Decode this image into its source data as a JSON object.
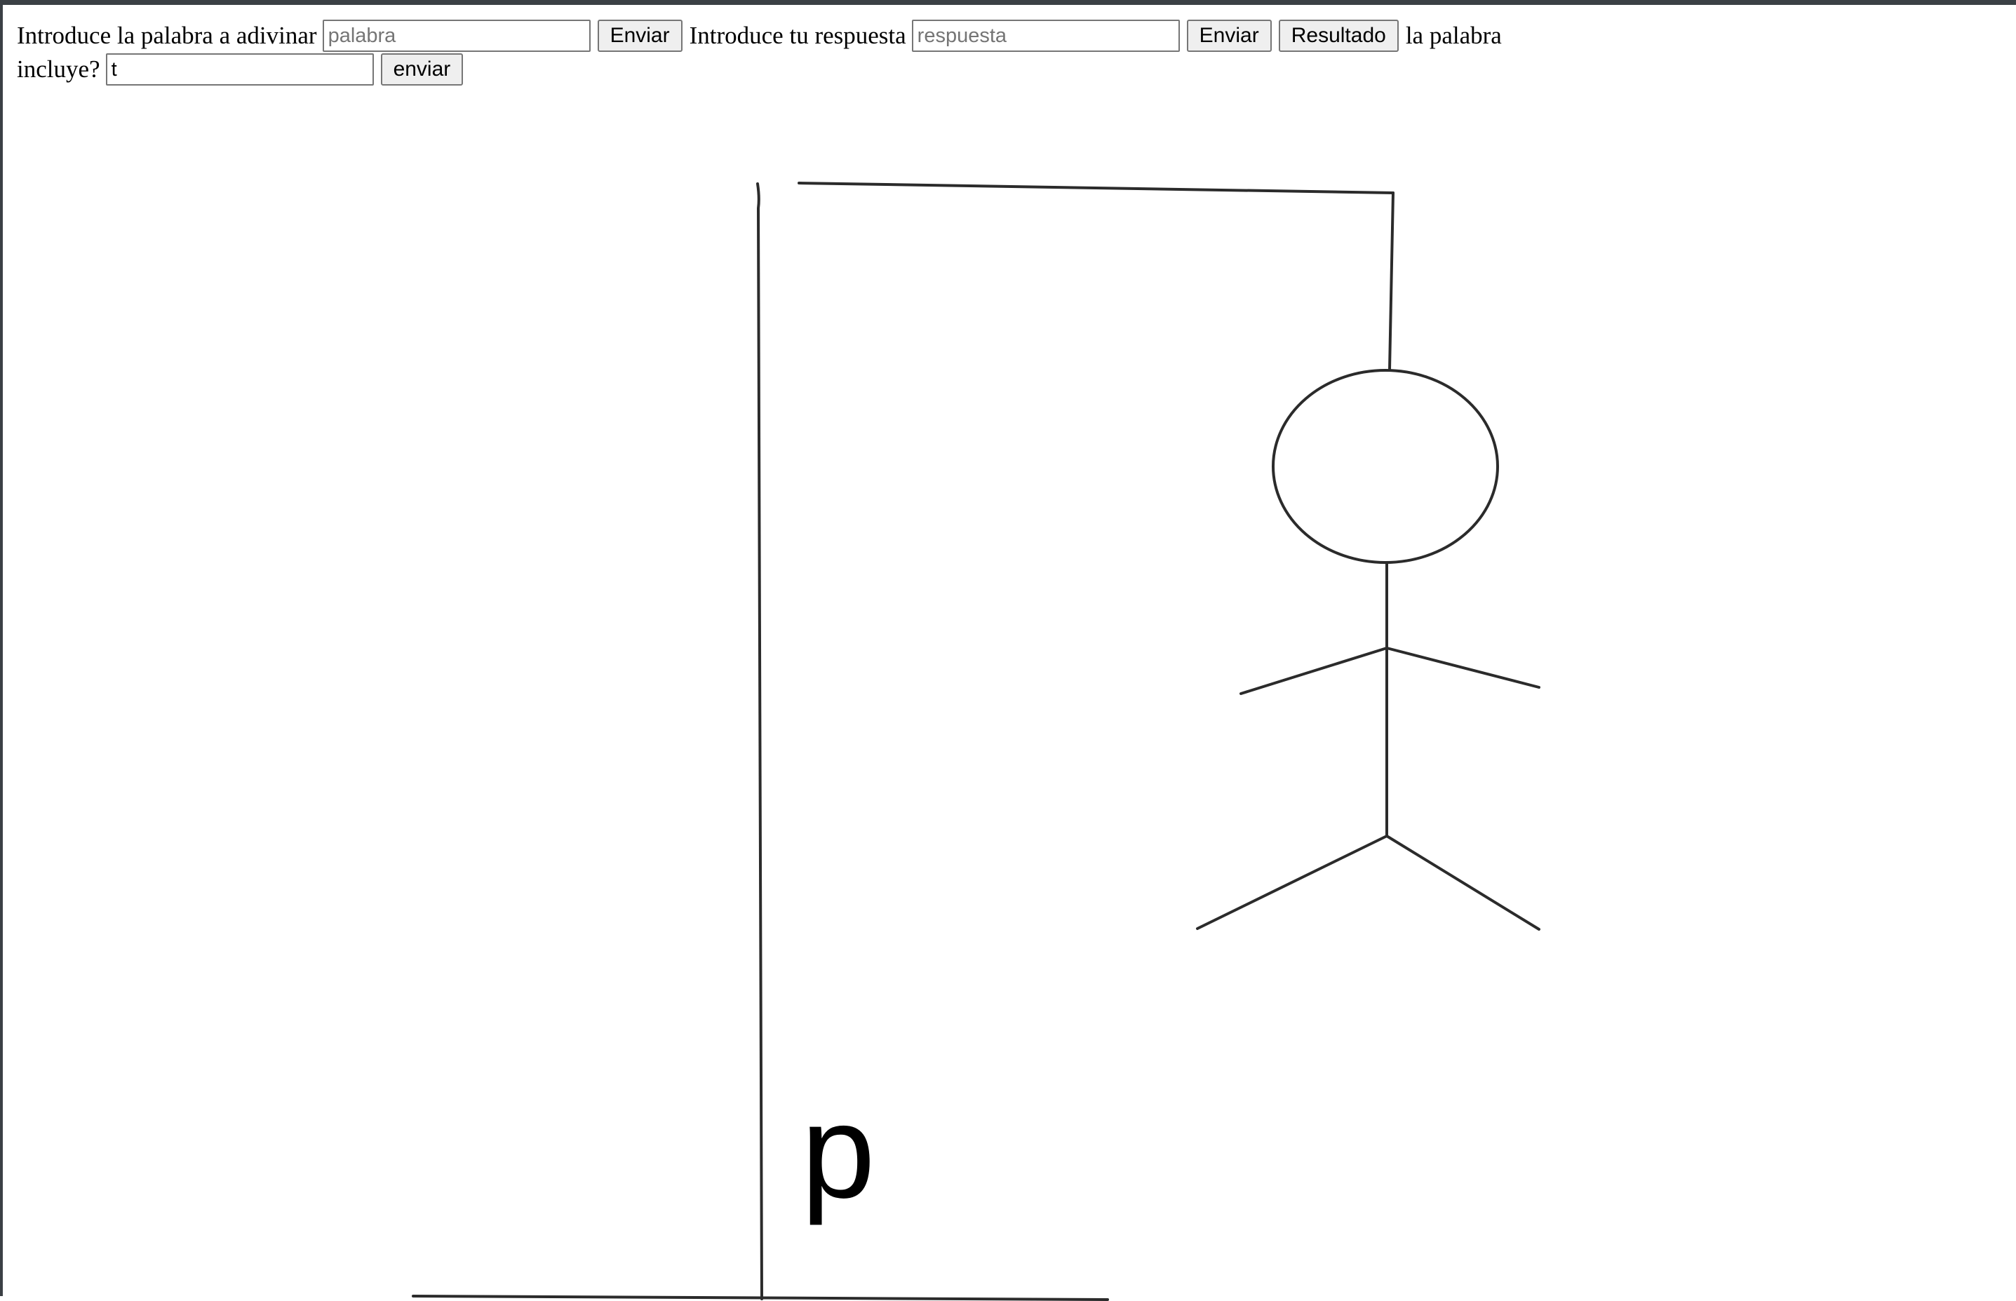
{
  "form": {
    "word_label": "Introduce la palabra a adivinar",
    "word_placeholder": "palabra",
    "word_value": "",
    "word_submit": "Enviar",
    "answer_label": "Introduce tu respuesta",
    "answer_placeholder": "respuesta",
    "answer_value": "",
    "answer_submit": "Enviar",
    "result_button": "Resultado",
    "letter_label_part1": "la palabra",
    "letter_label_part2": "incluye?",
    "letter_value": "t",
    "letter_submit": "enviar"
  },
  "game": {
    "revealed_letters": "p",
    "hangman_parts_shown": [
      "gallows-base",
      "gallows-post",
      "gallows-beam",
      "rope",
      "head",
      "body",
      "left-arm",
      "right-arm",
      "left-leg",
      "right-leg"
    ]
  },
  "colors": {
    "stroke": "#2b2b2b",
    "page_background": "#ffffff",
    "window_border": "#3b4045"
  }
}
